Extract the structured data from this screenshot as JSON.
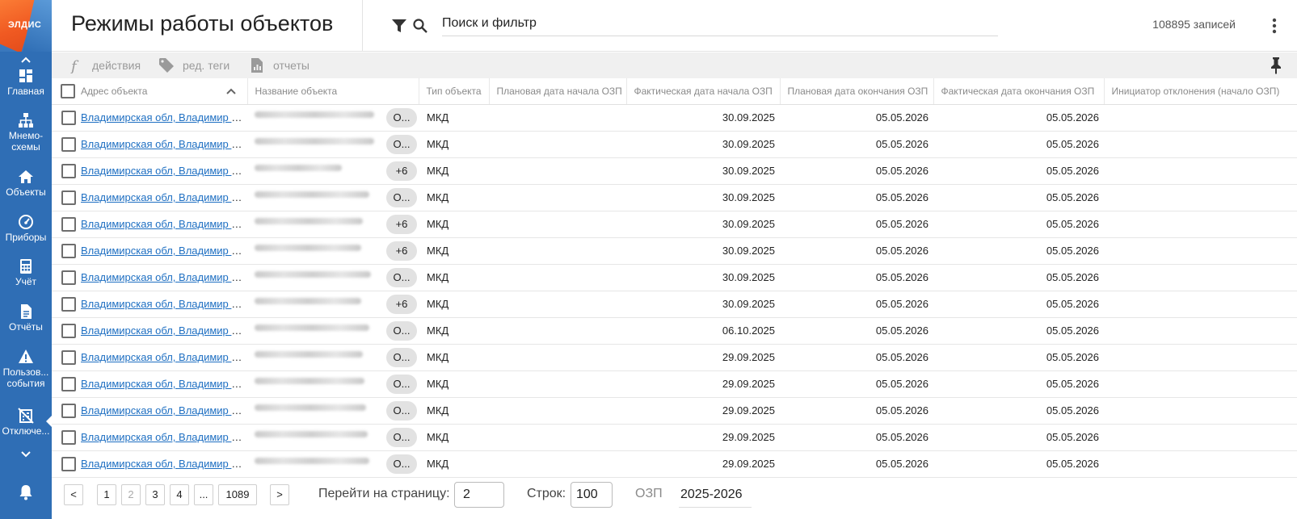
{
  "app": {
    "logo_text": "ЭЛДИС"
  },
  "sidebar": {
    "items": [
      {
        "id": "home",
        "label": "Главная",
        "icon": "dashboard-icon"
      },
      {
        "id": "mnemo",
        "label": "Мнемо-схемы",
        "label_lines": [
          "Мнемо-",
          "схемы"
        ],
        "icon": "sitemap-icon"
      },
      {
        "id": "objects",
        "label": "Объекты",
        "icon": "home-icon"
      },
      {
        "id": "devices",
        "label": "Приборы",
        "icon": "gauge-icon"
      },
      {
        "id": "accounting",
        "label": "Учёт",
        "icon": "calculator-icon"
      },
      {
        "id": "reports",
        "label": "Отчёты",
        "icon": "document-icon"
      },
      {
        "id": "user-events",
        "label": "Пользов... события",
        "label_lines": [
          "Пользов...",
          "события"
        ],
        "icon": "warning-icon"
      },
      {
        "id": "outages",
        "label": "Отключе...",
        "icon": "building-off-icon",
        "active": true
      }
    ],
    "notifications_icon": "bell-icon"
  },
  "header": {
    "title": "Режимы работы объектов",
    "search_placeholder": "Поиск и фильтр",
    "records_count": "108895 записей"
  },
  "toolbar": {
    "actions_label": "действия",
    "tags_label": "ред. теги",
    "reports_label": "отчеты"
  },
  "table": {
    "columns": [
      "Адрес объекта",
      "Название объекта",
      "Тип объекта",
      "Плановая дата начала ОЗП",
      "Фактическая дата начала ОЗП",
      "Плановая дата окончания ОЗП",
      "Фактическая дата окончания ОЗП",
      "Инициатор отклонения (начало ОЗП)"
    ],
    "rows": [
      {
        "address": "Владимирская обл, Владимир г,...",
        "chip": "О...",
        "type": "МКД",
        "planned_start": "",
        "actual_start": "30.09.2025",
        "planned_end": "05.05.2026",
        "actual_end": "05.05.2026",
        "initiator": ""
      },
      {
        "address": "Владимирская обл, Владимир г,...",
        "chip": "О...",
        "type": "МКД",
        "planned_start": "",
        "actual_start": "30.09.2025",
        "planned_end": "05.05.2026",
        "actual_end": "05.05.2026",
        "initiator": ""
      },
      {
        "address": "Владимирская обл, Владимир г,...",
        "chip": "+6",
        "type": "МКД",
        "planned_start": "",
        "actual_start": "30.09.2025",
        "planned_end": "05.05.2026",
        "actual_end": "05.05.2026",
        "initiator": ""
      },
      {
        "address": "Владимирская обл, Владимир г,...",
        "chip": "О...",
        "type": "МКД",
        "planned_start": "",
        "actual_start": "30.09.2025",
        "planned_end": "05.05.2026",
        "actual_end": "05.05.2026",
        "initiator": ""
      },
      {
        "address": "Владимирская обл, Владимир г,...",
        "chip": "+6",
        "type": "МКД",
        "planned_start": "",
        "actual_start": "30.09.2025",
        "planned_end": "05.05.2026",
        "actual_end": "05.05.2026",
        "initiator": ""
      },
      {
        "address": "Владимирская обл, Владимир г,...",
        "chip": "+6",
        "type": "МКД",
        "planned_start": "",
        "actual_start": "30.09.2025",
        "planned_end": "05.05.2026",
        "actual_end": "05.05.2026",
        "initiator": ""
      },
      {
        "address": "Владимирская обл, Владимир г,...",
        "chip": "О...",
        "type": "МКД",
        "planned_start": "",
        "actual_start": "30.09.2025",
        "planned_end": "05.05.2026",
        "actual_end": "05.05.2026",
        "initiator": ""
      },
      {
        "address": "Владимирская обл, Владимир г,...",
        "chip": "+6",
        "type": "МКД",
        "planned_start": "",
        "actual_start": "30.09.2025",
        "planned_end": "05.05.2026",
        "actual_end": "05.05.2026",
        "initiator": ""
      },
      {
        "address": "Владимирская обл, Владимир г,...",
        "chip": "О...",
        "type": "МКД",
        "planned_start": "",
        "actual_start": "06.10.2025",
        "planned_end": "05.05.2026",
        "actual_end": "05.05.2026",
        "initiator": ""
      },
      {
        "address": "Владимирская обл, Владимир г,...",
        "chip": "О...",
        "type": "МКД",
        "planned_start": "",
        "actual_start": "29.09.2025",
        "planned_end": "05.05.2026",
        "actual_end": "05.05.2026",
        "initiator": ""
      },
      {
        "address": "Владимирская обл, Владимир г,...",
        "chip": "О...",
        "type": "МКД",
        "planned_start": "",
        "actual_start": "29.09.2025",
        "planned_end": "05.05.2026",
        "actual_end": "05.05.2026",
        "initiator": ""
      },
      {
        "address": "Владимирская обл, Владимир г,...",
        "chip": "О...",
        "type": "МКД",
        "planned_start": "",
        "actual_start": "29.09.2025",
        "planned_end": "05.05.2026",
        "actual_end": "05.05.2026",
        "initiator": ""
      },
      {
        "address": "Владимирская обл, Владимир г,...",
        "chip": "О...",
        "type": "МКД",
        "planned_start": "",
        "actual_start": "29.09.2025",
        "planned_end": "05.05.2026",
        "actual_end": "05.05.2026",
        "initiator": ""
      },
      {
        "address": "Владимирская обл, Владимир г,...",
        "chip": "О...",
        "type": "МКД",
        "planned_start": "",
        "actual_start": "29.09.2025",
        "planned_end": "05.05.2026",
        "actual_end": "05.05.2026",
        "initiator": ""
      }
    ]
  },
  "pagination": {
    "prev": "<",
    "next": ">",
    "pages": [
      "1",
      "2",
      "3",
      "4",
      "...",
      "1089"
    ],
    "current_page": "2",
    "goto_label": "Перейти на страницу:",
    "goto_value": "2",
    "rows_label": "Строк:",
    "rows_value": "100",
    "ozp_label": "ОЗП",
    "ozp_value": "2025-2026"
  }
}
